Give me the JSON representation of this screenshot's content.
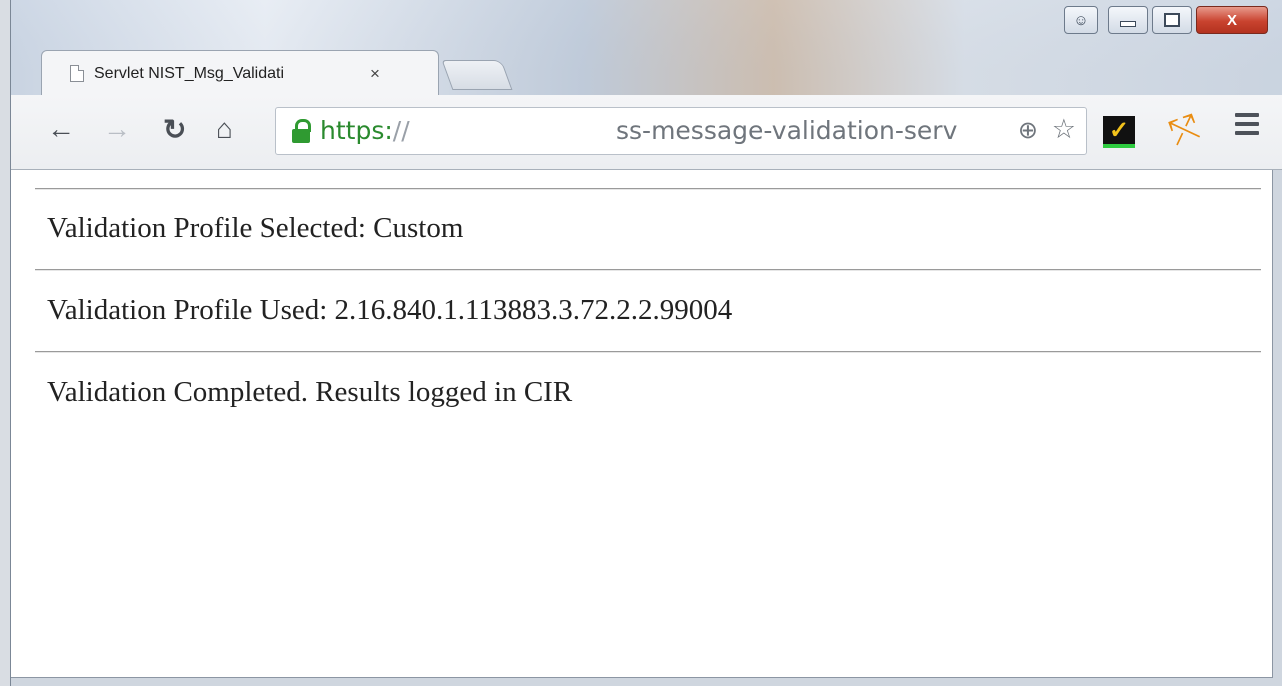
{
  "tab": {
    "title": "Servlet NIST_Msg_Validati",
    "close_glyph": "×"
  },
  "omnibox": {
    "scheme": "https:",
    "slash": "//",
    "url_tail": "ss-message-validation-serv"
  },
  "window_controls": {
    "user": "user-icon",
    "min": "minimize-icon",
    "max": "maximize-icon",
    "close": "X"
  },
  "content": {
    "profile_selected": "Validation Profile Selected: Custom",
    "profile_used": "Validation Profile Used: 2.16.840.1.113883.3.72.2.2.99004",
    "completed": "Validation Completed. Results logged in CIR"
  }
}
